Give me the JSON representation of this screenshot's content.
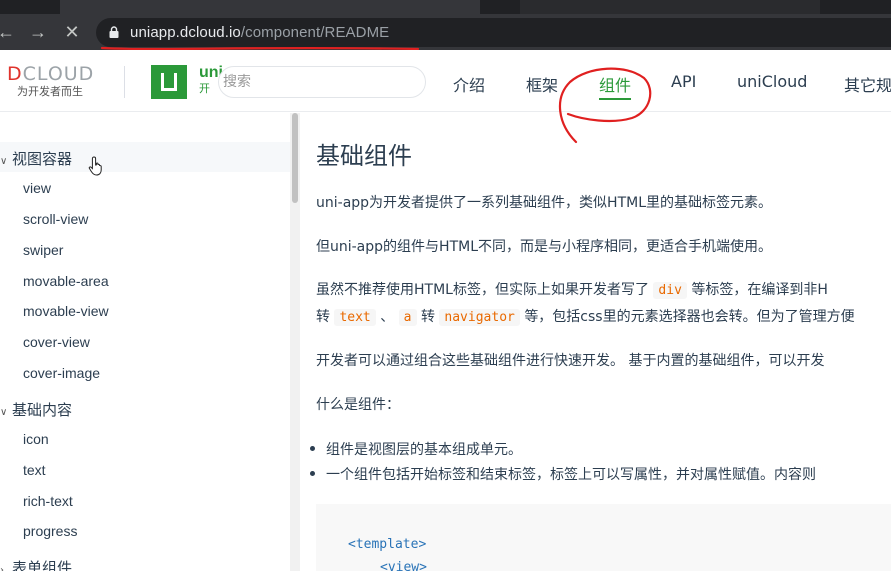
{
  "browser": {
    "url_host": "uniapp.dcloud.io",
    "url_path": "/component/README",
    "icons": [
      "back-arrow-icon",
      "forward-arrow-icon",
      "stop-loading-icon",
      "lock-icon"
    ]
  },
  "header": {
    "dcloud_logo_text": "DCLOUD",
    "dcloud_slogan": "为开发者而生",
    "uni_logo_text": "uni",
    "uni_logo_sub": "开",
    "search_placeholder": "搜索",
    "nav": [
      "介绍",
      "框架",
      "组件",
      "API",
      "uniCloud",
      "其它规"
    ],
    "active_nav": "组件",
    "brand_color": "#2b9939"
  },
  "sidebar": {
    "groups": [
      {
        "label": "视图容器",
        "items": [
          "view",
          "scroll-view",
          "swiper",
          "movable-area",
          "movable-view",
          "cover-view",
          "cover-image"
        ]
      },
      {
        "label": "基础内容",
        "items": [
          "icon",
          "text",
          "rich-text",
          "progress"
        ]
      },
      {
        "label": "表单组件",
        "items": []
      }
    ]
  },
  "content": {
    "title": "基础组件",
    "p1": "uni-app为开发者提供了一系列基础组件，类似HTML里的基础标签元素。",
    "p2": "但uni-app的组件与HTML不同，而是与小程序相同，更适合手机端使用。",
    "p3_a": "虽然不推荐使用HTML标签，但实际上如果开发者写了",
    "p3_code1": "div",
    "p3_b": "等标签，在编译到非H",
    "p4_a": "转",
    "p4_code1": "text",
    "p4_b": "、",
    "p4_code2": "a",
    "p4_c": "转",
    "p4_code3": "navigator",
    "p4_d": "等，包括css里的元素选择器也会转。但为了管理方便",
    "p5": "开发者可以通过组合这些基础组件进行快速开发。 基于内置的基础组件，可以开发",
    "p6": "什么是组件：",
    "bullets": [
      "组件是视图层的基本组成单元。",
      "一个组件包括开始标签和结束标签，标签上可以写属性，并对属性赋值。内容则"
    ],
    "code_lines": [
      "<template>",
      "<view>"
    ]
  },
  "colors": {
    "annotation_red": "#e02020",
    "inline_code": "#e96900",
    "code_tag": "#2973b7"
  }
}
